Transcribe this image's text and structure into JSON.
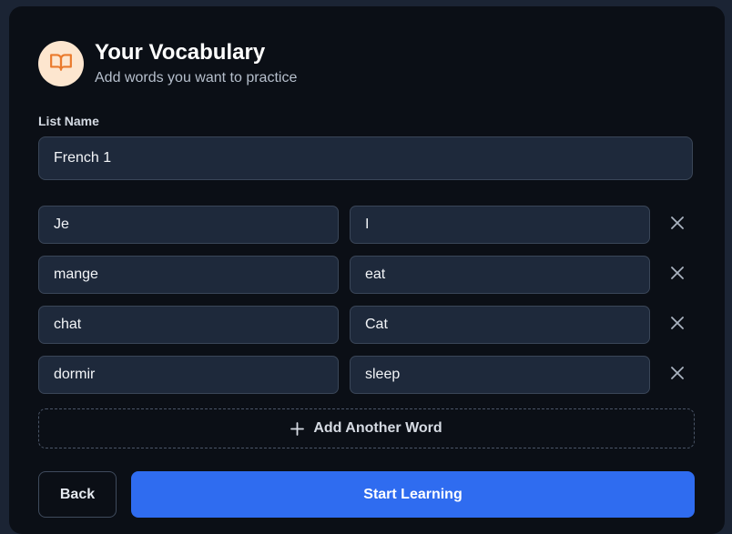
{
  "header": {
    "title": "Your Vocabulary",
    "subtitle": "Add words you want to practice",
    "icon": "book-open-icon",
    "icon_color": "#ea7a2c",
    "icon_bg": "#fde6cf"
  },
  "list": {
    "label": "List Name",
    "value": "French 1"
  },
  "words": [
    {
      "term": "Je",
      "definition": "I"
    },
    {
      "term": "mange",
      "definition": "eat"
    },
    {
      "term": "chat",
      "definition": "Cat"
    },
    {
      "term": "dormir",
      "definition": "sleep"
    }
  ],
  "actions": {
    "remove_icon": "close-icon",
    "add_label": "Add Another Word",
    "add_icon": "plus-icon",
    "back_label": "Back",
    "start_label": "Start Learning"
  },
  "colors": {
    "primary": "#2f6cf0",
    "card_bg": "#0b0f16",
    "page_bg": "#1b2434",
    "field_bg": "#1e293b"
  }
}
